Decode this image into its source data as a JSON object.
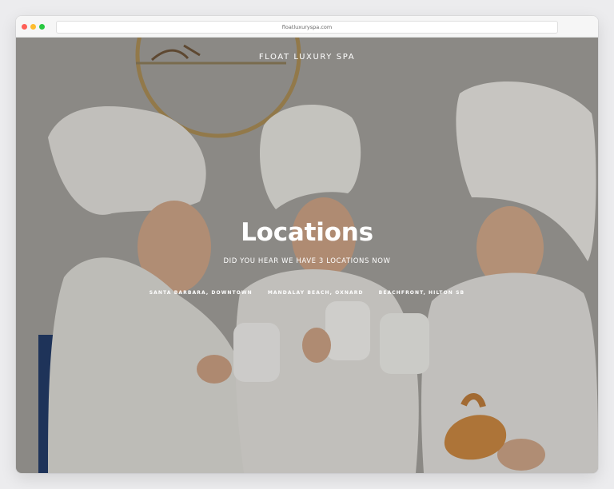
{
  "browser": {
    "url": "floatluxuryspa.com",
    "traffic_light_colors": [
      "#fe5f57",
      "#febc2e",
      "#28c840"
    ]
  },
  "site": {
    "brand": "FLOAT LUXURY SPA",
    "hero_title": "Locations",
    "subtitle": "DID YOU HEAR WE HAVE 3 LOCATIONS NOW",
    "locations": [
      "SANTA BARBARA, DOWNTOWN",
      "MANDALAY BEACH, OXNARD",
      "BEACHFRONT, HILTON SB"
    ]
  },
  "hero_image": {
    "description_icon": "three-women-in-towels-and-robes-photo"
  }
}
